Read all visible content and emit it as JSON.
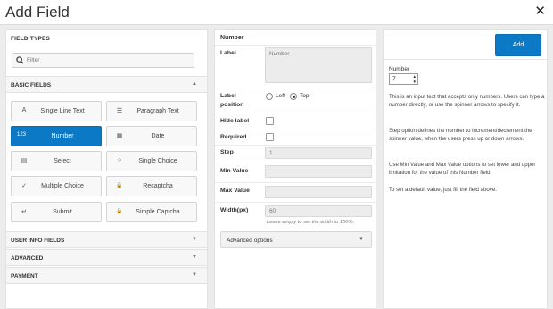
{
  "modal": {
    "title": "Add Field",
    "close_symbol": "✕"
  },
  "left": {
    "field_types_title": "FIELD TYPES",
    "search_placeholder": "Filter",
    "basic_fields_title": "BASIC FIELDS",
    "basic_fields": [
      {
        "label": "Single Line Text",
        "icon": "A"
      },
      {
        "label": "Paragraph Text",
        "icon": "☰"
      },
      {
        "label": "Number",
        "icon": "123"
      },
      {
        "label": "Date",
        "icon": "▦"
      },
      {
        "label": "Select",
        "icon": "▤"
      },
      {
        "label": "Single Choice",
        "icon": "○"
      },
      {
        "label": "Multiple Choice",
        "icon": "✓"
      },
      {
        "label": "Recaptcha",
        "icon": "🔒"
      },
      {
        "label": "Submit",
        "icon": "↵"
      },
      {
        "label": "Simple Captcha",
        "icon": "🔒"
      }
    ],
    "sections": [
      {
        "label": "USER INFO FIELDS"
      },
      {
        "label": "ADVANCED"
      },
      {
        "label": "PAYMENT"
      }
    ]
  },
  "middle": {
    "heading": "Number",
    "label_label": "Label",
    "label_value": "Number",
    "label_position_label": "Label position",
    "position_left": "Left",
    "position_top": "Top",
    "hide_label_label": "Hide label",
    "required_label": "Required",
    "step_label": "Step",
    "step_placeholder": "1",
    "min_value_label": "Min Value",
    "max_value_label": "Max Value",
    "width_label": "Width(px)",
    "width_value": "60",
    "width_hint": "Leave empty to set the width to 100%.",
    "advanced_options": "Advanced options"
  },
  "right": {
    "add_label": "Add",
    "number_label": "Number",
    "number_value": "7",
    "descriptions": [
      "This is an input text that accepts only numbers. Users can type a number directly, or use the spinner arrows to specify it.",
      "Step option defines the number to increment/decrement the spinner value, when the users press up or down arrows.",
      "Use Min Value and Max Value options to set lower and upper limitation for the value of this Number field.",
      "To set a default value, just fill the field above."
    ]
  },
  "colors": {
    "accent": "#0b79c5"
  }
}
